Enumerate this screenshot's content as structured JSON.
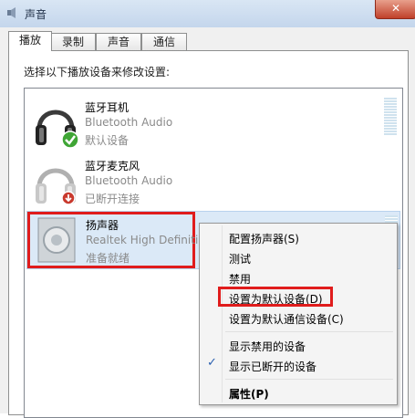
{
  "window": {
    "title": "声音",
    "close_label": "✕"
  },
  "tabs": [
    {
      "label": "播放",
      "active": true
    },
    {
      "label": "录制",
      "active": false
    },
    {
      "label": "声音",
      "active": false
    },
    {
      "label": "通信",
      "active": false
    }
  ],
  "instruction": "选择以下播放设备来修改设置:",
  "devices": [
    {
      "name": "蓝牙耳机",
      "driver": "Bluetooth Audio",
      "status": "默认设备",
      "icon": "headphones-icon",
      "badge": "green-check-badge-icon"
    },
    {
      "name": "蓝牙麦克风",
      "driver": "Bluetooth Audio",
      "status": "已断开连接",
      "icon": "headphones-icon",
      "badge": "red-down-arrow-badge-icon"
    },
    {
      "name": "扬声器",
      "driver": "Realtek High Definiti",
      "status": "准备就绪",
      "icon": "speaker-icon"
    }
  ],
  "context_menu": {
    "items": [
      {
        "label": "配置扬声器(S)"
      },
      {
        "label": "测试"
      },
      {
        "label": "禁用"
      },
      {
        "label": "设置为默认设备(D)",
        "highlighted": true
      },
      {
        "label": "设置为默认通信设备(C)"
      },
      {
        "label": "显示禁用的设备"
      },
      {
        "label": "显示已断开的设备",
        "checked": true
      },
      {
        "label": "属性(P)",
        "bold": true
      }
    ],
    "check_mark": "✓"
  },
  "colors": {
    "annotation_red": "#e01c1c",
    "check_green": "#3fa535",
    "selection_blue": "#dbe9f7"
  }
}
